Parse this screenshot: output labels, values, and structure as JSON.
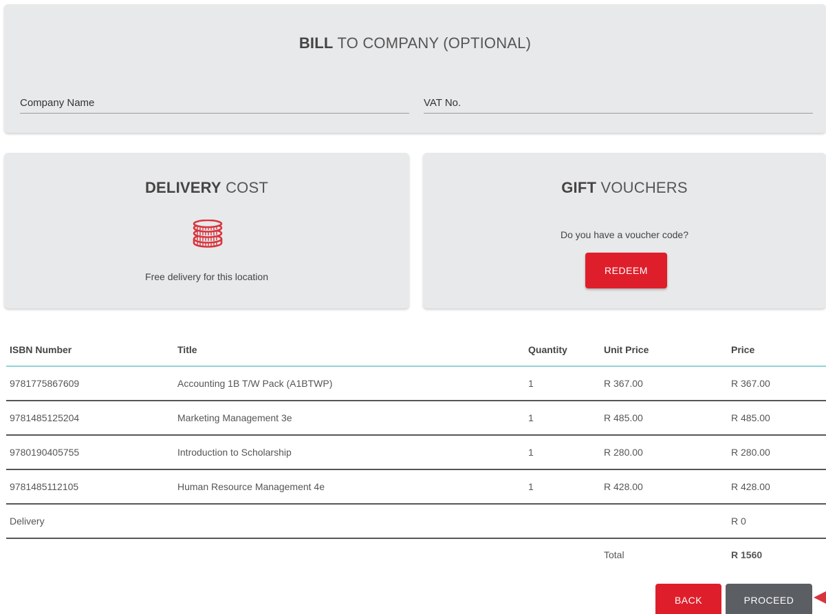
{
  "bill_to": {
    "title_bold": "BILL",
    "title_rest": "TO COMPANY (OPTIONAL)",
    "company_placeholder": "Company Name",
    "vat_placeholder": "VAT No."
  },
  "delivery": {
    "title_bold": "DELIVERY",
    "title_rest": "COST",
    "icon": "coins-icon",
    "text": "Free delivery for this location"
  },
  "vouchers": {
    "title_bold": "GIFT",
    "title_rest": "VOUCHERS",
    "text": "Do you have a voucher code?",
    "redeem_label": "REDEEM"
  },
  "table": {
    "headers": [
      "ISBN Number",
      "Title",
      "Quantity",
      "Unit Price",
      "Price"
    ],
    "rows": [
      {
        "isbn": "9781775867609",
        "title": "Accounting 1B T/W Pack (A1BTWP)",
        "qty": "1",
        "unit": "R 367.00",
        "price": "R 367.00"
      },
      {
        "isbn": "9781485125204",
        "title": "Marketing Management 3e",
        "qty": "1",
        "unit": "R 485.00",
        "price": "R 485.00"
      },
      {
        "isbn": "9780190405755",
        "title": "Introduction to Scholarship",
        "qty": "1",
        "unit": "R 280.00",
        "price": "R 280.00"
      },
      {
        "isbn": "9781485112105",
        "title": "Human Resource Management 4e",
        "qty": "1",
        "unit": "R 428.00",
        "price": "R 428.00"
      }
    ],
    "delivery_label": "Delivery",
    "delivery_price": "R 0",
    "total_label": "Total",
    "total_value": "R 1560"
  },
  "actions": {
    "back_label": "BACK",
    "proceed_label": "PROCEED"
  },
  "colors": {
    "accent_red": "#de1f2b",
    "proceed_gray": "#5b5e63",
    "header_line": "#8fd3d6",
    "card_bg": "#e8e9ea"
  }
}
